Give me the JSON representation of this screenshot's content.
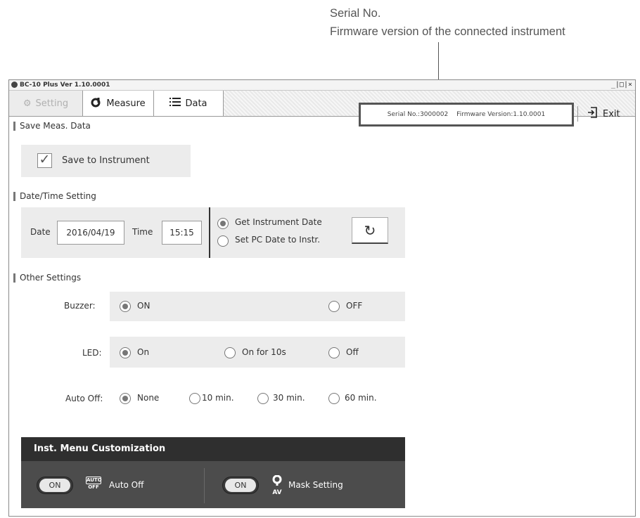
{
  "annotation": {
    "line1": "Serial No.",
    "line2": "Firmware version of the connected instrument"
  },
  "window": {
    "title": "BC-10 Plus Ver 1.10.0001",
    "controls": "_|□|×"
  },
  "tabs": {
    "setting": "Setting",
    "measure": "Measure",
    "data": "Data"
  },
  "status": {
    "serial": "Serial No.:3000002",
    "firmware": "Firmware Version:1.10.0001"
  },
  "exit_label": "Exit",
  "save_section": {
    "title": "Save Meas. Data",
    "checkbox_label": "Save to Instrument",
    "checked": true
  },
  "datetime_section": {
    "title": "Date/Time Setting",
    "date_label": "Date",
    "date_value": "2016/04/19",
    "time_label": "Time",
    "time_value": "15:15",
    "option_get": "Get Instrument Date",
    "option_set": "Set PC Date to Instr."
  },
  "other_section": {
    "title": "Other Settings",
    "buzzer_label": "Buzzer:",
    "buzzer_on": "ON",
    "buzzer_off": "OFF",
    "led_label": "LED:",
    "led_on": "On",
    "led_on10": "On for 10s",
    "led_off": "Off",
    "autooff_label": "Auto Off:",
    "autooff_none": "None",
    "autooff_10": "10 min.",
    "autooff_30": "30 min.",
    "autooff_60": "60 min."
  },
  "menu_section": {
    "title": "Inst. Menu Customization",
    "item1_toggle": "ON",
    "item1_icon_top": "AUTO",
    "item1_icon_bottom": "OFF",
    "item1_label": "Auto Off",
    "item2_toggle": "ON",
    "item2_icon_text": "AV",
    "item2_label": "Mask Setting"
  }
}
